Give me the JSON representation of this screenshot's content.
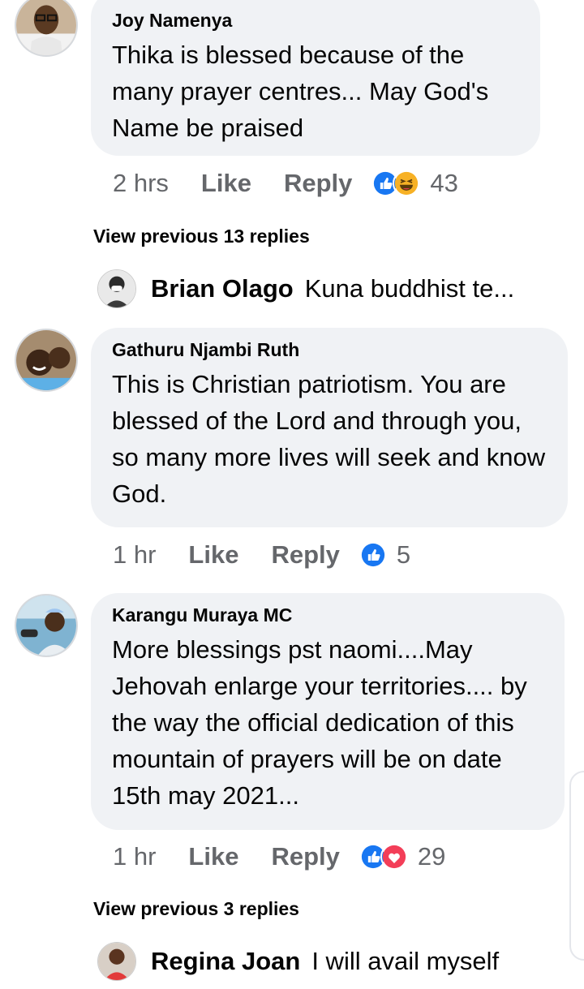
{
  "comments": [
    {
      "author": "Joy Namenya",
      "text": "Thika is blessed because of the many prayer centres... May God's Name be praised",
      "time": "2 hrs",
      "like": "Like",
      "reply": "Reply",
      "reactions": [
        "like-icon",
        "haha-icon"
      ],
      "reaction_count": "43"
    },
    {
      "author": "Gathuru Njambi Ruth",
      "text": "This is Christian patriotism. You are blessed of the Lord and through you, so many more lives will seek and know God.",
      "time": "1 hr",
      "like": "Like",
      "reply": "Reply",
      "reactions": [
        "like-icon"
      ],
      "reaction_count": "5"
    },
    {
      "author": "Karangu Muraya MC",
      "text": "More blessings pst naomi....May Jehovah enlarge your territories.... by the way the official dedication of this mountain of prayers will be on date 15th may 2021...",
      "time": "1 hr",
      "like": "Like",
      "reply": "Reply",
      "reactions": [
        "like-icon",
        "love-icon"
      ],
      "reaction_count": "29"
    }
  ],
  "view_previous_1": "View previous 13 replies",
  "reply_preview_1": {
    "name": "Brian Olago",
    "text": "Kuna buddhist te..."
  },
  "view_previous_2": "View previous 3 replies",
  "reply_preview_2": {
    "name": "Regina Joan",
    "text": "I will avail myself"
  },
  "colors": {
    "like_blue": "#1877f2",
    "haha_yellow": "#f7b125",
    "love_red": "#f33e58",
    "bubble_bg": "#f0f2f5",
    "meta_gray": "#65676b"
  }
}
